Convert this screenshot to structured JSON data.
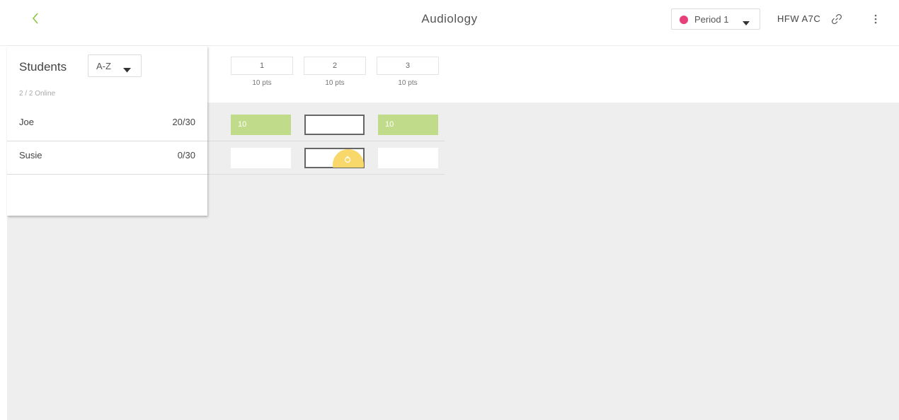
{
  "topbar": {
    "title": "Audiology",
    "period": {
      "label": "Period 1",
      "dot_color": "#e6407a"
    },
    "class_code": "HFW A7C",
    "icons": [
      "back-chevron-icon",
      "link-icon",
      "more-vertical-icon"
    ]
  },
  "students_panel": {
    "heading": "Students",
    "sort": "A-Z",
    "online": "2 / 2 Online",
    "students": [
      {
        "name": "Joe",
        "score": "20/30"
      },
      {
        "name": "Susie",
        "score": "0/30"
      }
    ]
  },
  "questions": [
    {
      "number": "1",
      "points": "10 pts"
    },
    {
      "number": "2",
      "points": "10 pts"
    },
    {
      "number": "3",
      "points": "10 pts"
    }
  ],
  "grid": {
    "rows": [
      [
        "10",
        "",
        "10"
      ],
      [
        "",
        "",
        ""
      ]
    ]
  },
  "colors": {
    "accent_green": "#8cc63f",
    "correct_cell": "#c0dc8a",
    "period_dot": "#e6407a",
    "cursor_highlight": "#f9d86b"
  }
}
